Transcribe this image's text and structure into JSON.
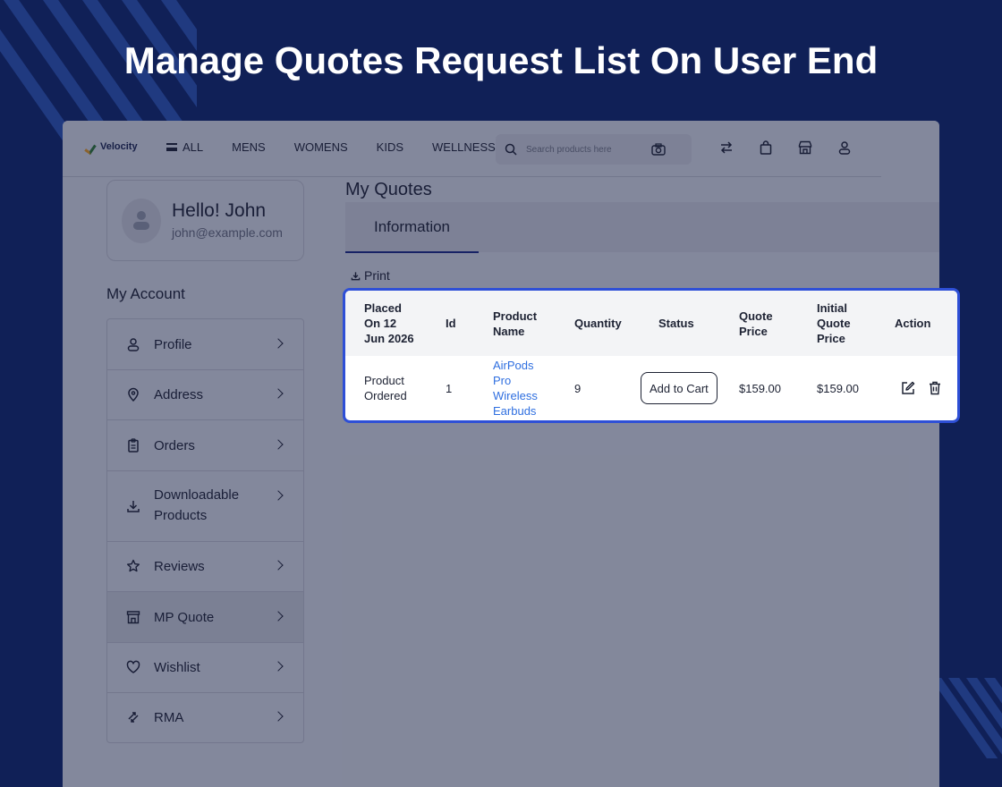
{
  "headline": "Manage Quotes Request List On User End",
  "app": {
    "logo_text": "Velocity",
    "nav": [
      "ALL",
      "MENS",
      "WOMENS",
      "KIDS",
      "WELLNESS"
    ],
    "search_placeholder": "Search products here",
    "header_icons": [
      "compare-icon",
      "bag-icon",
      "store-icon",
      "user-icon"
    ]
  },
  "profile": {
    "greeting": "Hello! John",
    "email": "john@example.com"
  },
  "sidebar": {
    "title": "My Account",
    "items": [
      {
        "label": "Profile",
        "icon": "user-icon"
      },
      {
        "label": "Address",
        "icon": "location-pin-icon"
      },
      {
        "label": "Orders",
        "icon": "clipboard-icon"
      },
      {
        "label": "Downloadable Products",
        "icon": "download-icon"
      },
      {
        "label": "Reviews",
        "icon": "star-icon"
      },
      {
        "label": "MP Quote",
        "icon": "store-icon",
        "active": true
      },
      {
        "label": "Wishlist",
        "icon": "heart-icon"
      },
      {
        "label": "RMA",
        "icon": "return-arrows-icon"
      }
    ]
  },
  "main": {
    "title": "My Quotes",
    "tab": "Information",
    "print_label": "Print"
  },
  "quotes_table": {
    "columns": [
      "Placed On 12 Jun 2026",
      "Id",
      "Product Name",
      "Quantity",
      "Status",
      "Quote Price",
      "Initial Quote Price",
      "Action"
    ],
    "rows": [
      {
        "placed": "Product Ordered",
        "id": "1",
        "product": "AirPods Pro Wireless Earbuds",
        "quantity": "9",
        "status_button": "Add to Cart",
        "quote_price": "$159.00",
        "initial_price": "$159.00"
      }
    ]
  },
  "colors": {
    "background": "#102057",
    "highlight_border": "#2e4fd6",
    "link": "#2f6fe0"
  }
}
